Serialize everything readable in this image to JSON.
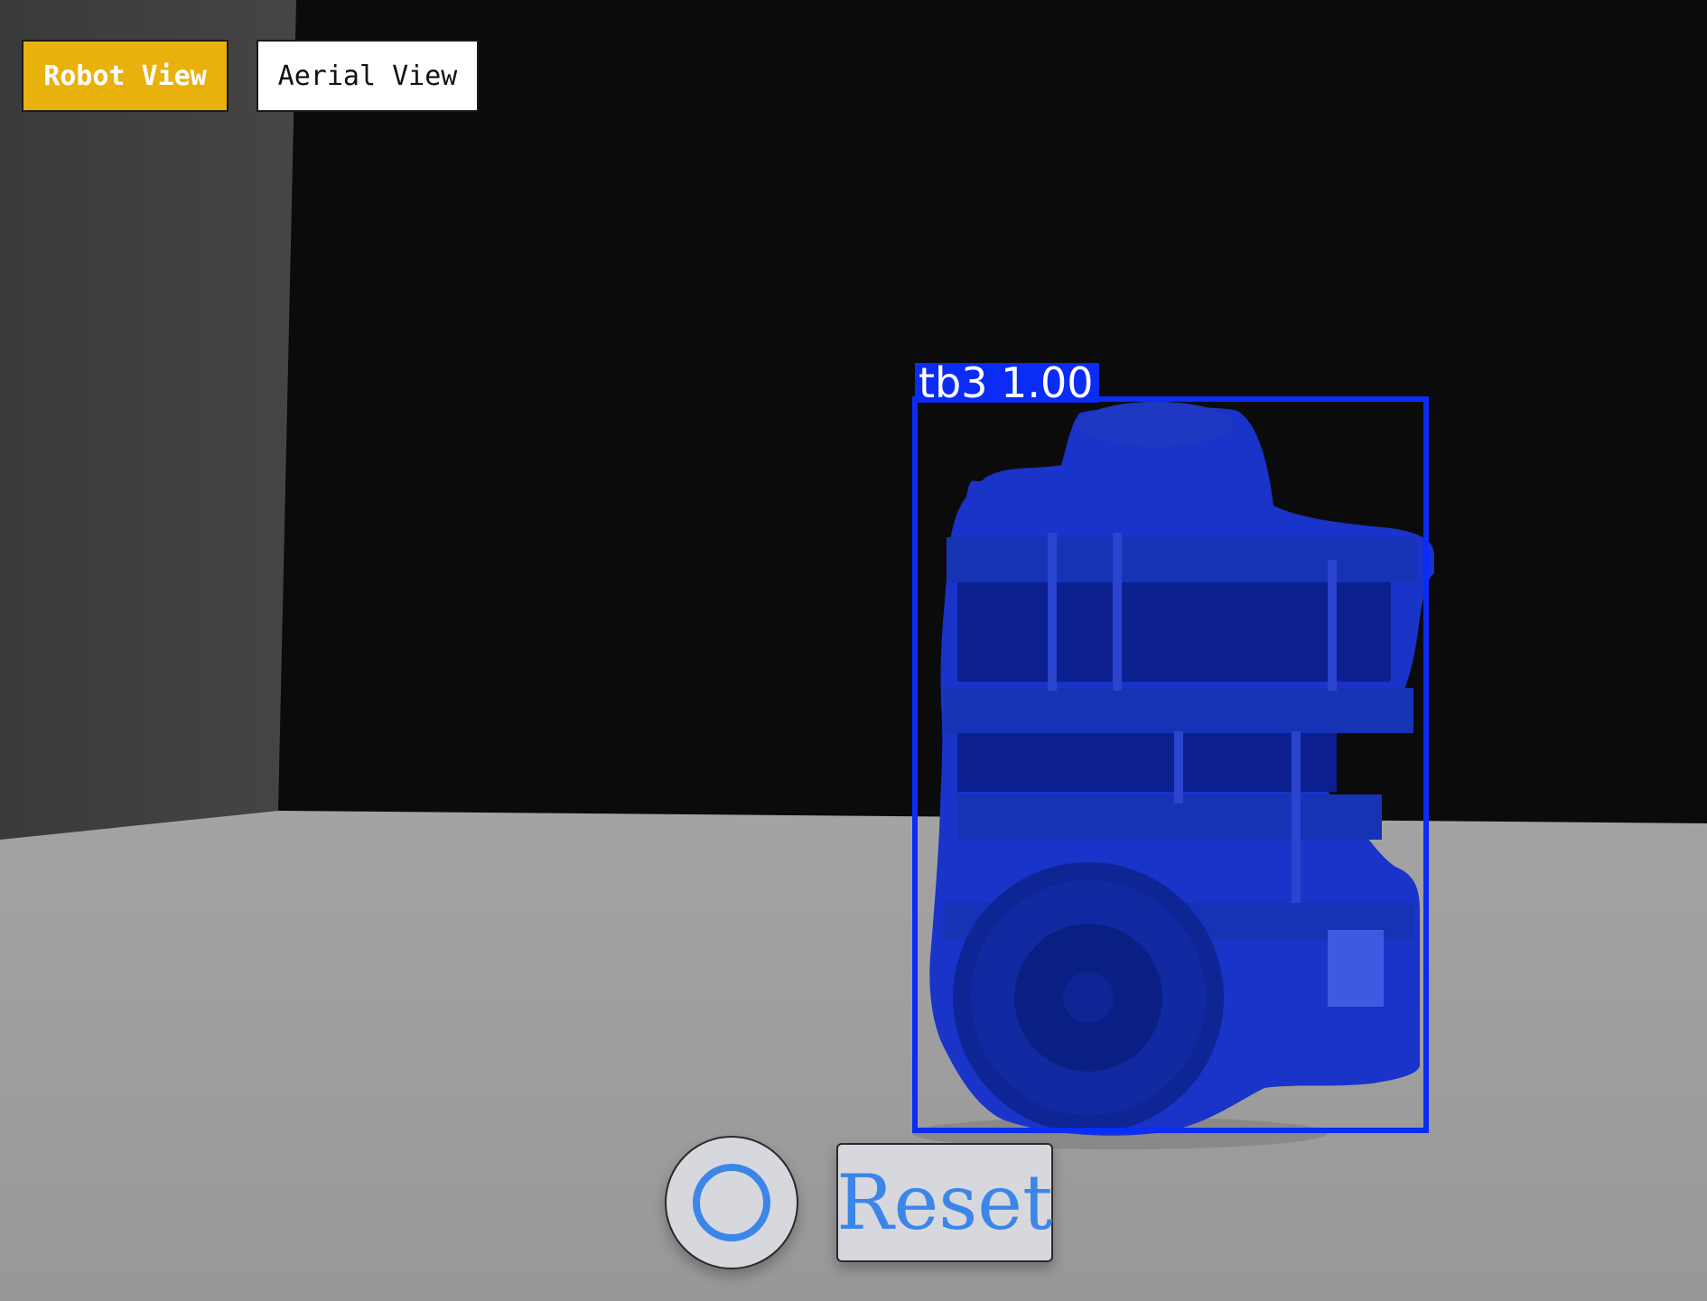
{
  "view_toggle": {
    "robot_view_label": "Robot View",
    "aerial_view_label": "Aerial View",
    "active": "Robot View"
  },
  "detection": {
    "label": "tb3 1.00",
    "class_name": "tb3",
    "confidence": 1.0
  },
  "controls": {
    "record_icon": "circle-icon",
    "reset_label": "Reset"
  },
  "colors": {
    "active_button": "#e9b10c",
    "inactive_button": "#ffffff",
    "detection_box": "#0a2cf5",
    "segmentation_mask": "#1a33c8",
    "control_accent": "#3b86e8",
    "wall_left": "#3f3f3f",
    "wall_back": "#0b0b0b",
    "floor": "#9c9c9c"
  }
}
